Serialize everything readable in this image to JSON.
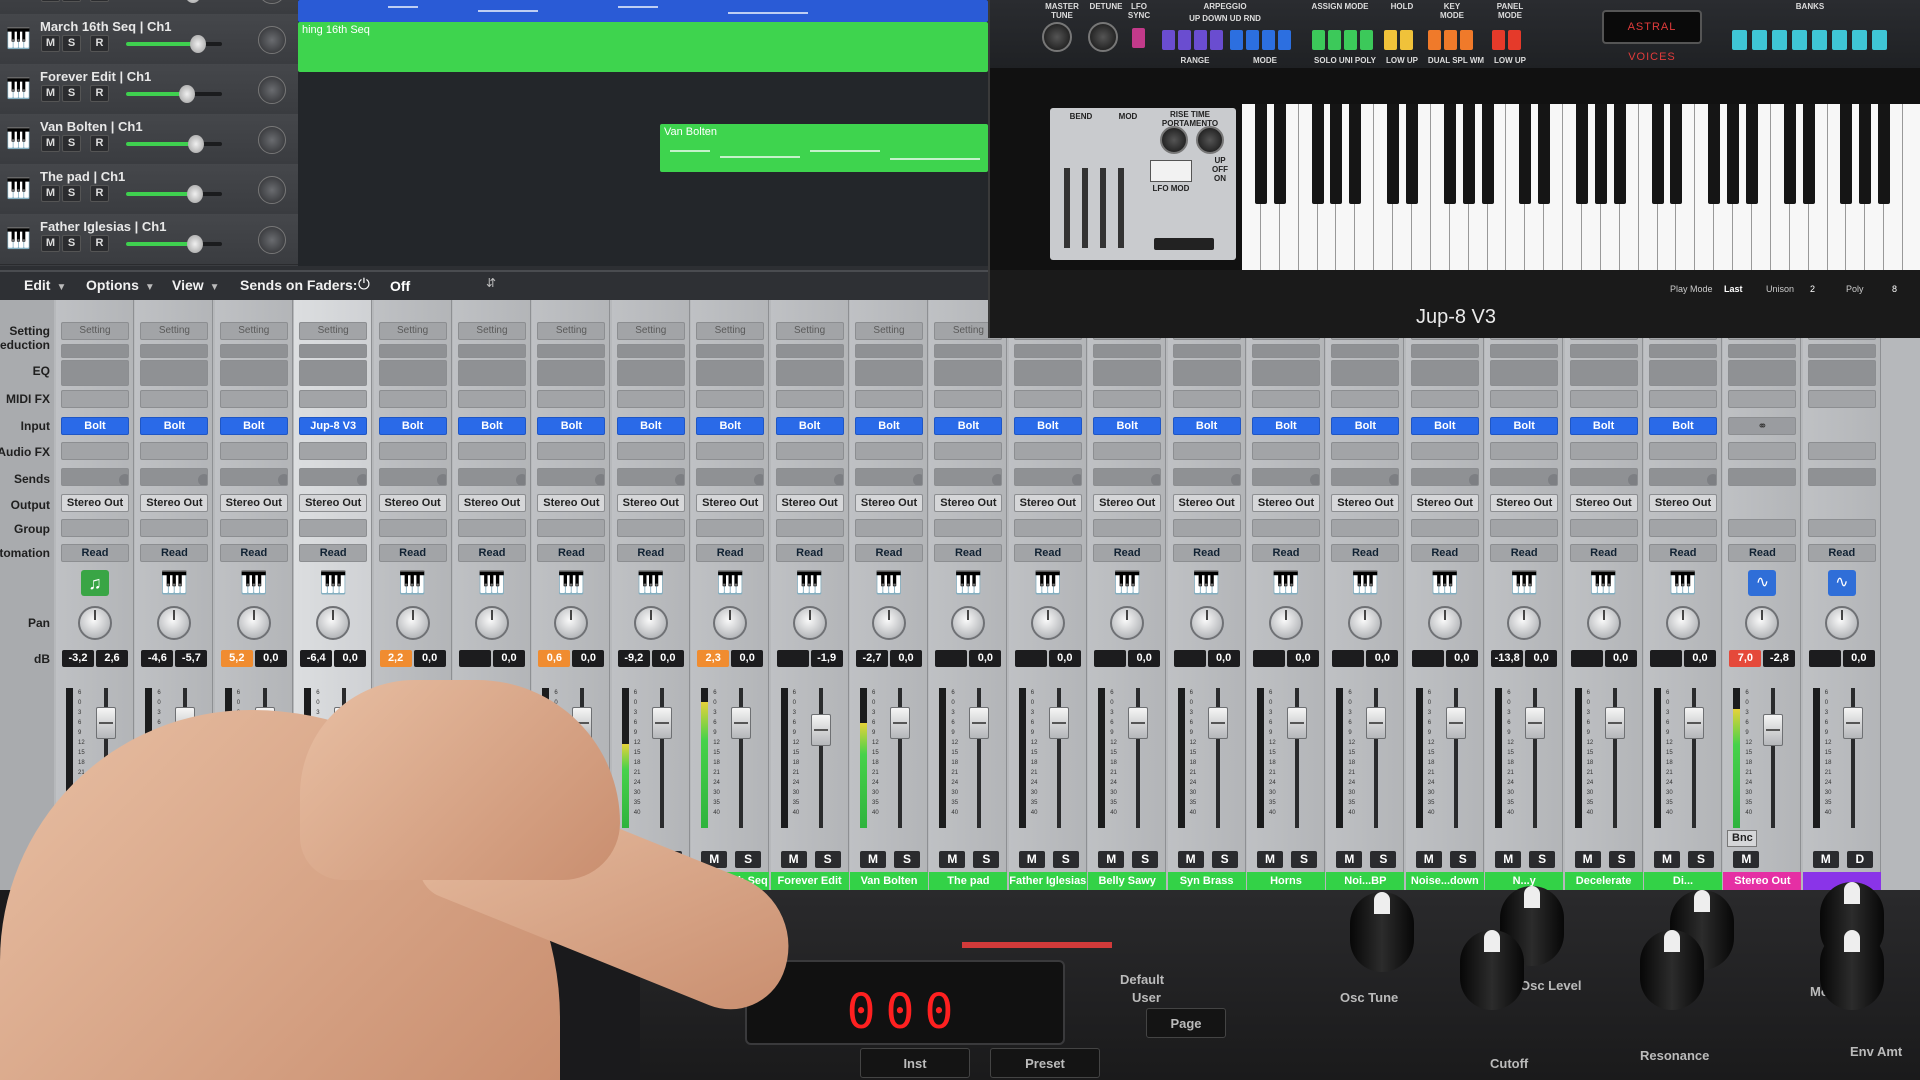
{
  "arrange": {
    "tracks": [
      {
        "name": "",
        "m": "M",
        "s": "S",
        "r": "R",
        "vol": 0.7
      },
      {
        "name": "March 16th Seq | Ch1",
        "m": "M",
        "s": "S",
        "r": "R",
        "vol": 0.75
      },
      {
        "name": "Forever Edit | Ch1",
        "m": "M",
        "s": "S",
        "r": "R",
        "vol": 0.64
      },
      {
        "name": "Van Bolten | Ch1",
        "m": "M",
        "s": "S",
        "r": "R",
        "vol": 0.73
      },
      {
        "name": "The pad | Ch1",
        "m": "M",
        "s": "S",
        "r": "R",
        "vol": 0.72
      },
      {
        "name": "Father Iglesias | Ch1",
        "m": "M",
        "s": "S",
        "r": "R",
        "vol": 0.72
      }
    ],
    "regions": [
      {
        "label": "hing 16th Seq"
      },
      {
        "label": "Van Bolten"
      }
    ],
    "colors": {
      "region_green": "#3ed44e",
      "region_blue": "#2a5bd6"
    }
  },
  "mixer_menu": {
    "edit": "Edit",
    "options": "Options",
    "view": "View",
    "sends_label": "Sends on Faders:",
    "sends_value": "Off"
  },
  "row_labels": {
    "setting": "Setting",
    "reduction": "Reduction",
    "eq": "EQ",
    "midi_fx": "MIDI FX",
    "input": "Input",
    "audio_fx": "Audio FX",
    "sends": "Sends",
    "output": "Output",
    "group": "Group",
    "automation": "Automation",
    "pan": "Pan",
    "db": "dB"
  },
  "strips": [
    {
      "setting": "Setting",
      "input": "Bolt",
      "output": "Stereo Out",
      "auto": "Read",
      "icon": "music-note",
      "db1": "-3,2",
      "db2": "2,6",
      "db1_color": "dark",
      "meter": 0.0,
      "fader": 0.25,
      "m": "",
      "s": "",
      "name": ""
    },
    {
      "setting": "Setting",
      "input": "Bolt",
      "output": "Stereo Out",
      "auto": "Read",
      "icon": "piano",
      "db1": "-4,6",
      "db2": "-5,7",
      "db1_color": "dark",
      "meter": 0.0,
      "fader": 0.25,
      "m": "",
      "s": "",
      "name": ""
    },
    {
      "setting": "Setting",
      "input": "Bolt",
      "output": "Stereo Out",
      "auto": "Read",
      "icon": "piano",
      "db1": "5,2",
      "db2": "0,0",
      "db1_color": "orange",
      "meter": 0.0,
      "fader": 0.25,
      "m": "",
      "s": "",
      "name": ""
    },
    {
      "setting": "Setting",
      "input": "Jup-8 V3",
      "output": "Stereo Out",
      "auto": "Read",
      "icon": "piano",
      "db1": "-6,4",
      "db2": "0,0",
      "db1_color": "dark",
      "meter": 0.0,
      "fader": 0.25,
      "m": "",
      "s": "",
      "name": ""
    },
    {
      "setting": "Setting",
      "input": "Bolt",
      "output": "Stereo Out",
      "auto": "Read",
      "icon": "piano",
      "db1": "2,2",
      "db2": "0,0",
      "db1_color": "orange",
      "meter": 0.0,
      "fader": 0.25,
      "m": "",
      "s": "",
      "name": ""
    },
    {
      "setting": "Setting",
      "input": "Bolt",
      "output": "Stereo Out",
      "auto": "Read",
      "icon": "piano",
      "db1": "",
      "db2": "0,0",
      "db1_color": "dark",
      "meter": 0.0,
      "fader": 0.25,
      "m": "",
      "s": "",
      "name": ""
    },
    {
      "setting": "Setting",
      "input": "Bolt",
      "output": "Stereo Out",
      "auto": "Read",
      "icon": "piano",
      "db1": "0,6",
      "db2": "0,0",
      "db1_color": "orange",
      "meter": 0.85,
      "fader": 0.25,
      "m": "",
      "s": "",
      "name": ""
    },
    {
      "setting": "Setting",
      "input": "Bolt",
      "output": "Stereo Out",
      "auto": "Read",
      "icon": "piano",
      "db1": "-9,2",
      "db2": "0,0",
      "db1_color": "dark",
      "meter": 0.6,
      "fader": 0.25,
      "m": "",
      "s": "S",
      "name": ""
    },
    {
      "setting": "Setting",
      "input": "Bolt",
      "output": "Stereo Out",
      "auto": "Read",
      "icon": "piano",
      "db1": "2,3",
      "db2": "0,0",
      "db1_color": "orange",
      "meter": 0.9,
      "fader": 0.25,
      "m": "M",
      "s": "S",
      "name": "March...th Seq"
    },
    {
      "setting": "Setting",
      "input": "Bolt",
      "output": "Stereo Out",
      "auto": "Read",
      "icon": "piano",
      "db1": "",
      "db2": "-1,9",
      "db1_color": "dark",
      "meter": 0.0,
      "fader": 0.3,
      "m": "M",
      "s": "S",
      "name": "Forever Edit"
    },
    {
      "setting": "Setting",
      "input": "Bolt",
      "output": "Stereo Out",
      "auto": "Read",
      "icon": "piano",
      "db1": "-2,7",
      "db2": "0,0",
      "db1_color": "dark",
      "meter": 0.75,
      "fader": 0.25,
      "m": "M",
      "s": "S",
      "name": "Van Bolten"
    },
    {
      "setting": "Setting",
      "input": "Bolt",
      "output": "Stereo Out",
      "auto": "Read",
      "icon": "piano",
      "db1": "",
      "db2": "0,0",
      "db1_color": "dark",
      "meter": 0.0,
      "fader": 0.25,
      "m": "M",
      "s": "S",
      "name": "The pad"
    },
    {
      "setting": "Setting",
      "input": "Bolt",
      "output": "Stereo Out",
      "auto": "Read",
      "icon": "piano",
      "db1": "",
      "db2": "0,0",
      "db1_color": "dark",
      "meter": 0.0,
      "fader": 0.25,
      "m": "M",
      "s": "S",
      "name": "Father Iglesias"
    },
    {
      "setting": "Setting",
      "input": "Bolt",
      "output": "Stereo Out",
      "auto": "Read",
      "icon": "piano",
      "db1": "",
      "db2": "0,0",
      "db1_color": "dark",
      "meter": 0.0,
      "fader": 0.25,
      "m": "M",
      "s": "S",
      "name": "Belly Sawy"
    },
    {
      "setting": "Setting",
      "input": "Bolt",
      "output": "Stereo Out",
      "auto": "Read",
      "icon": "piano",
      "db1": "",
      "db2": "0,0",
      "db1_color": "dark",
      "meter": 0.0,
      "fader": 0.25,
      "m": "M",
      "s": "S",
      "name": "Syn Brass"
    },
    {
      "setting": "Setting",
      "input": "Bolt",
      "output": "Stereo Out",
      "auto": "Read",
      "icon": "piano",
      "db1": "",
      "db2": "0,0",
      "db1_color": "dark",
      "meter": 0.0,
      "fader": 0.25,
      "m": "M",
      "s": "S",
      "name": "Horns"
    },
    {
      "setting": "Setting",
      "input": "Bolt",
      "output": "Stereo Out",
      "auto": "Read",
      "icon": "piano",
      "db1": "",
      "db2": "0,0",
      "db1_color": "dark",
      "meter": 0.0,
      "fader": 0.25,
      "m": "M",
      "s": "S",
      "name": "Noi...BP"
    },
    {
      "setting": "Setting",
      "input": "Bolt",
      "output": "Stereo Out",
      "auto": "Read",
      "icon": "piano",
      "db1": "",
      "db2": "0,0",
      "db1_color": "dark",
      "meter": 0.0,
      "fader": 0.25,
      "m": "M",
      "s": "S",
      "name": "Noise...down"
    },
    {
      "setting": "Setting",
      "input": "Bolt",
      "output": "Stereo Out",
      "auto": "Read",
      "icon": "piano",
      "db1": "-13,8",
      "db2": "0,0",
      "db1_color": "dark",
      "meter": 0.0,
      "fader": 0.25,
      "m": "M",
      "s": "S",
      "name": "N...y"
    },
    {
      "setting": "Setting",
      "input": "Bolt",
      "output": "Stereo Out",
      "auto": "Read",
      "icon": "piano",
      "db1": "",
      "db2": "0,0",
      "db1_color": "dark",
      "meter": 0.0,
      "fader": 0.25,
      "m": "M",
      "s": "S",
      "name": "Decelerate"
    },
    {
      "setting": "Setting",
      "input": "Bolt",
      "output": "Stereo Out",
      "auto": "Read",
      "icon": "piano",
      "db1": "",
      "db2": "0,0",
      "db1_color": "dark",
      "meter": 0.0,
      "fader": 0.25,
      "m": "M",
      "s": "S",
      "name": "Di..."
    },
    {
      "setting": "",
      "input": "link",
      "output": "",
      "auto": "Read",
      "icon": "waveform",
      "db1": "7,0",
      "db2": "-2,8",
      "db1_color": "red",
      "meter": 0.85,
      "fader": 0.3,
      "m": "M",
      "s": "",
      "name": "Stereo Out",
      "bnc": "Bnc",
      "name_color": "pink"
    },
    {
      "setting": "",
      "input": "",
      "output": "",
      "auto": "Read",
      "icon": "waveform",
      "db1": "",
      "db2": "0,0",
      "db1_color": "dark",
      "meter": 0.0,
      "fader": 0.25,
      "m": "M",
      "s": "D",
      "name": "",
      "name_color": "purple"
    }
  ],
  "plugin": {
    "title": "Jup-8 V3",
    "patch_display": "ASTRAL VOICES",
    "labels": {
      "master_tune": "MASTER TUNE",
      "detune": "DETUNE",
      "lfo_sync": "LFO SYNC",
      "arpeggio": "ARPEGGIO",
      "up_down": "UP DOWN UD RND",
      "range": "RANGE",
      "mode": "MODE",
      "assign_mode": "ASSIGN MODE",
      "solo_uni_poly": "SOLO UNI POLY",
      "hold": "HOLD",
      "low_up": "LOW UP",
      "key_mode": "KEY MODE",
      "dual_spl_wm": "DUAL SPL WM",
      "panel_mode": "PANEL MODE",
      "banks": "BANKS",
      "bend": "BEND",
      "mod": "MOD",
      "lfo_mod": "LFO MOD",
      "portamento": "RISE TIME PORTAMENTO",
      "up_off_on": "UP OFF ON"
    },
    "footer": {
      "play_mode_label": "Play Mode",
      "play_mode_value": "Last",
      "unison_label": "Unison",
      "unison_value": "2",
      "poly_label": "Poly",
      "poly_value": "8"
    },
    "colors": {
      "purple": "#6a4dd0",
      "blue": "#2c6fe0",
      "green": "#3cc95a",
      "yellow": "#f0c23a",
      "orange": "#f07a2a",
      "red": "#e53a2a",
      "teal": "#3fc6d6"
    }
  },
  "hardware": {
    "display_digits": "000",
    "labels": {
      "default": "Default",
      "user": "User",
      "page": "Page",
      "inst": "Inst",
      "preset": "Preset",
      "osc_tune": "Osc Tune",
      "osc_level": "Osc Level",
      "cutoff": "Cutoff",
      "resonance": "Resonance",
      "env_amt": "Env Amt",
      "mod": "Mod"
    }
  }
}
